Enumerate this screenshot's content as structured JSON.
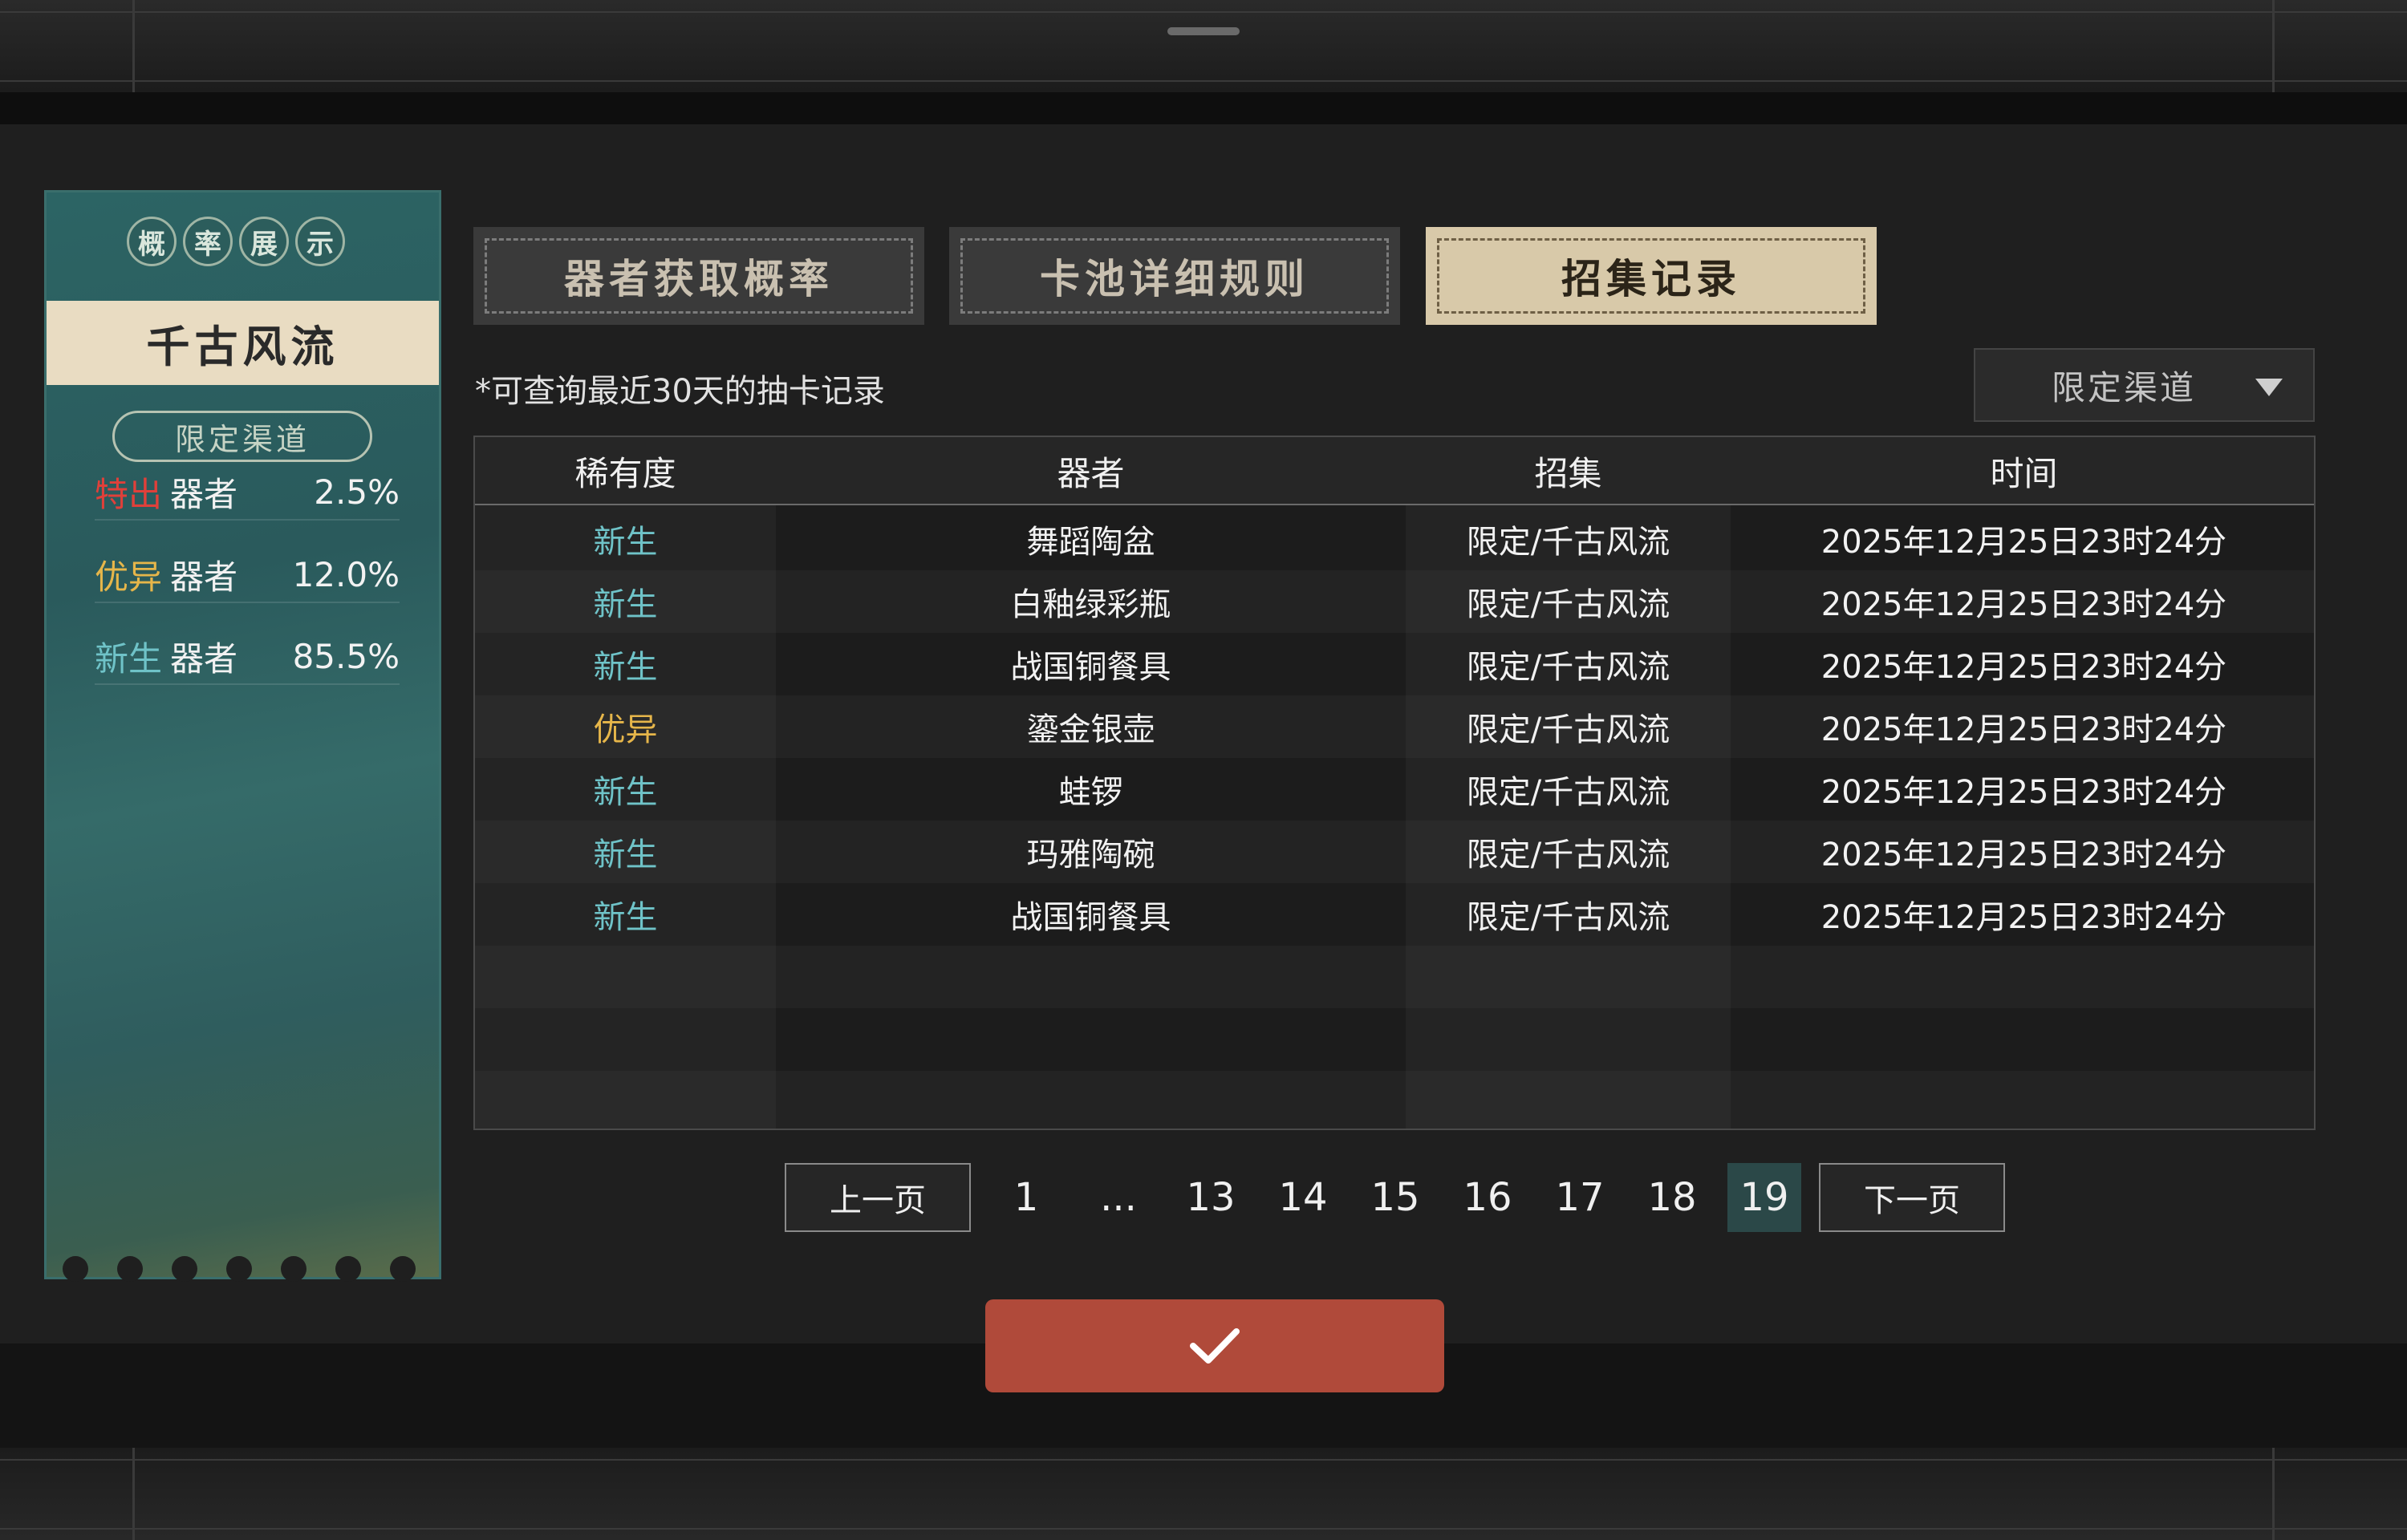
{
  "rates_panel": {
    "header_chars": [
      "概",
      "率",
      "展",
      "示"
    ],
    "pool_name": "千古风流",
    "channel_badge": "限定渠道",
    "rows": [
      {
        "tier": "特出",
        "unit": "器者",
        "pct": "2.5%",
        "color": "#e0403a"
      },
      {
        "tier": "优异",
        "unit": "器者",
        "pct": "12.0%",
        "color": "#e6b64a"
      },
      {
        "tier": "新生",
        "unit": "器者",
        "pct": "85.5%",
        "color": "#6fc3c8"
      }
    ]
  },
  "tabs": [
    {
      "label": "器者获取概率",
      "active": false
    },
    {
      "label": "卡池详细规则",
      "active": false
    },
    {
      "label": "招集记录",
      "active": true
    }
  ],
  "hint": "*可查询最近30天的抽卡记录",
  "filter": {
    "selected": "限定渠道"
  },
  "table": {
    "headers": [
      "稀有度",
      "器者",
      "招集",
      "时间"
    ],
    "rows": [
      {
        "rarity": "新生",
        "item": "舞蹈陶盆",
        "pool": "限定/千古风流",
        "time": "2025年12月25日23时24分"
      },
      {
        "rarity": "新生",
        "item": "白釉绿彩瓶",
        "pool": "限定/千古风流",
        "time": "2025年12月25日23时24分"
      },
      {
        "rarity": "新生",
        "item": "战国铜餐具",
        "pool": "限定/千古风流",
        "time": "2025年12月25日23时24分"
      },
      {
        "rarity": "优异",
        "item": "鎏金银壶",
        "pool": "限定/千古风流",
        "time": "2025年12月25日23时24分"
      },
      {
        "rarity": "新生",
        "item": "蛙锣",
        "pool": "限定/千古风流",
        "time": "2025年12月25日23时24分"
      },
      {
        "rarity": "新生",
        "item": "玛雅陶碗",
        "pool": "限定/千古风流",
        "time": "2025年12月25日23时24分"
      },
      {
        "rarity": "新生",
        "item": "战国铜餐具",
        "pool": "限定/千古风流",
        "time": "2025年12月25日23时24分"
      }
    ]
  },
  "rarity_colors": {
    "新生": "#6fc3c8",
    "优异": "#e6b64a",
    "特出": "#e0403a"
  },
  "pagination": {
    "prev": "上一页",
    "next": "下一页",
    "pages": [
      "1",
      "...",
      "13",
      "14",
      "15",
      "16",
      "17",
      "18",
      "19"
    ],
    "current": "19"
  },
  "confirm_icon": "check-icon"
}
